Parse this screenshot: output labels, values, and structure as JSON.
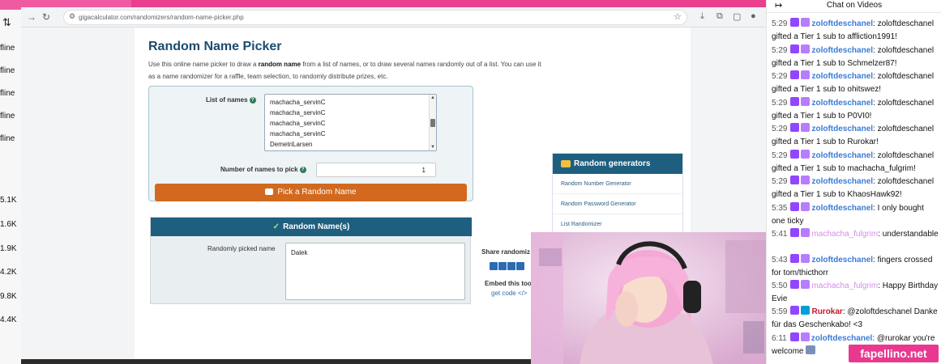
{
  "left_rail": {
    "items": [
      "fline",
      "fline",
      "fline",
      "fline",
      "fline",
      "5.1K",
      "1.6K",
      "1.9K",
      "4.2K",
      "9.8K",
      "4.4K"
    ]
  },
  "browser": {
    "url": "gigacalculator.com/randomizers/random-name-picker.php"
  },
  "page": {
    "title": "Random Name Picker",
    "intro_a": "Use this online name picker to draw a ",
    "intro_bold": "random name",
    "intro_b": " from a list of names, or to draw several names randomly out of a list. You can use it as a name randomizer for a raffle, team selection, to randomly distribute prizes, etc.",
    "list_label": "List of names",
    "names": [
      "machacha_servinC",
      "machacha_servinC",
      "machacha_servinC",
      "machacha_servinC",
      "DemetriLarsen"
    ],
    "count_label": "Number of names to pick",
    "count_value": "1",
    "pick_button": "Pick a Random Name",
    "result_title": "Random Name(s)",
    "result_label": "Randomly picked name",
    "result_value": "Dalek",
    "share_title": "Share randomiz",
    "embed_title": "Embed this too",
    "embed_link": "get code </>"
  },
  "generators": {
    "title": "Random generators",
    "items": [
      "Random Number Generator",
      "Random Password Generator",
      "List Randomizer"
    ]
  },
  "chat": {
    "title": "Chat on Videos",
    "messages": [
      {
        "time": "5:29",
        "user": "zoloftdeschanel",
        "text": ": zoloftdeschanel gifted a Tier 1 sub to affliction1991!"
      },
      {
        "time": "5:29",
        "user": "zoloftdeschanel",
        "text": ": zoloftdeschanel gifted a Tier 1 sub to Schmelzer87!"
      },
      {
        "time": "5:29",
        "user": "zoloftdeschanel",
        "text": ": zoloftdeschanel gifted a Tier 1 sub to ohitswez!"
      },
      {
        "time": "5:29",
        "user": "zoloftdeschanel",
        "text": ": zoloftdeschanel gifted a Tier 1 sub to P0VI0!"
      },
      {
        "time": "5:29",
        "user": "zoloftdeschanel",
        "text": ": zoloftdeschanel gifted a Tier 1 sub to Rurokar!"
      },
      {
        "time": "5:29",
        "user": "zoloftdeschanel",
        "text": ": zoloftdeschanel gifted a Tier 1 sub to machacha_fulgrim!"
      },
      {
        "time": "5:29",
        "user": "zoloftdeschanel",
        "text": ": zoloftdeschanel gifted a Tier 1 sub to KhaosHawk92!"
      },
      {
        "time": "5:35",
        "user": "zoloftdeschanel",
        "text": ": I only bought one ticky"
      },
      {
        "time": "5:41",
        "user": "machacha_fulgrim",
        "text": ": understandable"
      },
      {
        "time": "5:43",
        "user": "zoloftdeschanel",
        "text": ": fingers crossed for tom/thicthorr"
      },
      {
        "time": "5:50",
        "user": "machacha_fulgrim",
        "text": ": Happy Birthday Evie"
      },
      {
        "time": "5:59",
        "user": "Rurokar",
        "text": ": @zoloftdeschanel Danke für das Geschenkabo! <3"
      },
      {
        "time": "6:11",
        "user": "zoloftdeschanel",
        "text": ": @rurokar you're welcome"
      }
    ]
  },
  "watermark": "fapellino.net"
}
